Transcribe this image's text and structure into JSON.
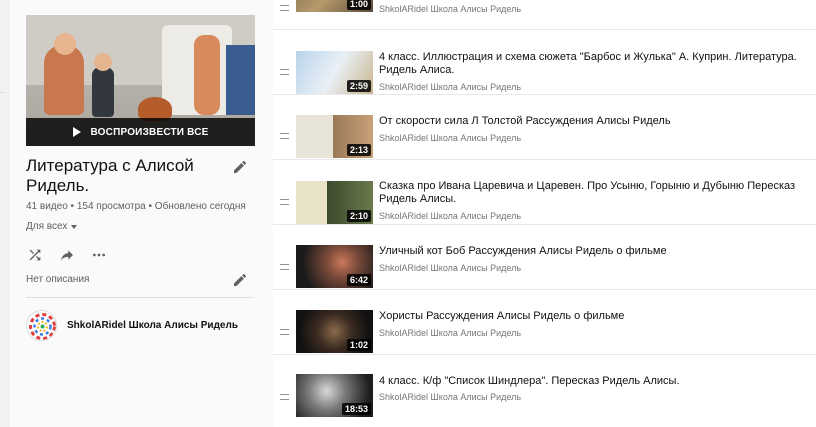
{
  "playlist": {
    "title": "Литература с Алисой Ридель.",
    "meta": "41 видео • 154 просмотра • Обновлено сегодня",
    "privacy": "Для всех",
    "play_all": "ВОСПРОИЗВЕСТИ ВСЕ",
    "description": "Нет описания",
    "owner": "ShkolARidel Школа Алисы Ридель"
  },
  "videos": [
    {
      "title": "",
      "owner": "ShkolARidel Школа Алисы Ридель",
      "duration": "1:00"
    },
    {
      "title": "4 класс. Иллюстрация и схема сюжета \"Барбос и Жулька\" А. Куприн. Литература. Ридель Алиса.",
      "owner": "ShkolARidel Школа Алисы Ридель",
      "duration": "2:59"
    },
    {
      "title": "От скорости сила Л Толстой Рассуждения Алисы Ридель",
      "owner": "ShkolARidel Школа Алисы Ридель",
      "duration": "2:13"
    },
    {
      "title": "Сказка про Ивана Царевича и Царевен. Про Усыню, Горыню и Дубыню Пересказ Ридель Алисы.",
      "owner": "ShkolARidel Школа Алисы Ридель",
      "duration": "2:10"
    },
    {
      "title": "Уличный кот Боб Рассуждения Алисы Ридель о фильме",
      "owner": "ShkolARidel Школа Алисы Ридель",
      "duration": "6:42"
    },
    {
      "title": "Хористы Рассуждения Алисы Ридель о фильме",
      "owner": "ShkolARidel Школа Алисы Ридель",
      "duration": "1:02"
    },
    {
      "title": "4 класс. К/ф \"Список Шиндлера\". Пересказ Ридель Алисы.",
      "owner": "ShkolARidel Школа Алисы Ридель",
      "duration": "18:53"
    }
  ]
}
